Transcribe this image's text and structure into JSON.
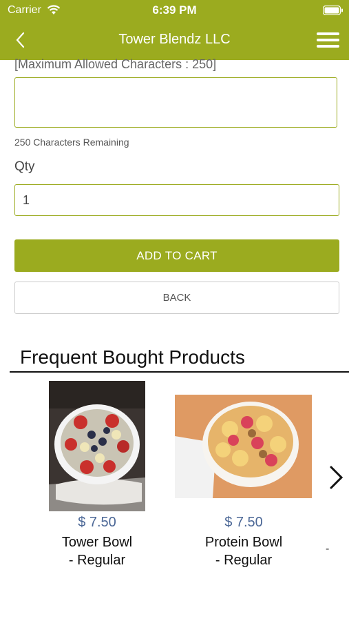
{
  "status": {
    "carrier": "Carrier",
    "time": "6:39 PM"
  },
  "header": {
    "title": "Tower Blendz LLC"
  },
  "form": {
    "max_chars_label": "[Maximum Allowed Characters : 250]",
    "instructions_value": "",
    "remaining_text": "250 Characters Remaining",
    "qty_label": "Qty",
    "qty_value": "1",
    "add_to_cart_label": "ADD TO CART",
    "back_label": "BACK"
  },
  "frequent": {
    "title": "Frequent Bought Products",
    "products": [
      {
        "price": "$ 7.50",
        "name_line1": "Tower Bowl",
        "name_line2": "- Regular"
      },
      {
        "price": "$ 7.50",
        "name_line1": "Protein Bowl",
        "name_line2": "- Regular"
      }
    ],
    "partial_next_text": "-"
  },
  "icons": {
    "back": "chevron-left-icon",
    "menu": "hamburger-menu-icon",
    "next": "chevron-right-icon",
    "wifi": "wifi-icon",
    "battery": "battery-icon"
  },
  "colors": {
    "brand": "#9bab1f",
    "price": "#4b6796"
  }
}
